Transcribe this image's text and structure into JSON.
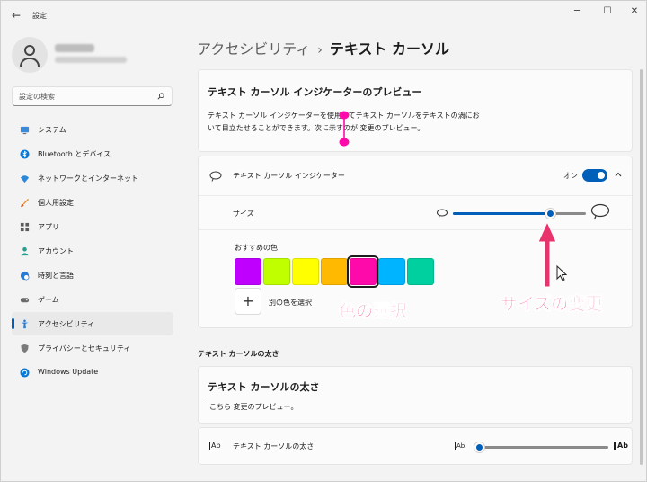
{
  "window": {
    "back_glyph": "←",
    "title": "設定",
    "controls": {
      "minimize": "─",
      "maximize": "☐",
      "close": "✕"
    }
  },
  "search": {
    "placeholder": "設定の検索",
    "value": ""
  },
  "sidebar": {
    "items": [
      {
        "label": "システム",
        "icon": "monitor-icon",
        "active": false
      },
      {
        "label": "Bluetooth とデバイス",
        "icon": "bluetooth-icon",
        "active": false
      },
      {
        "label": "ネットワークとインターネット",
        "icon": "wifi-icon",
        "active": false
      },
      {
        "label": "個人用設定",
        "icon": "brush-icon",
        "active": false
      },
      {
        "label": "アプリ",
        "icon": "apps-icon",
        "active": false
      },
      {
        "label": "アカウント",
        "icon": "person-icon",
        "active": false
      },
      {
        "label": "時刻と言語",
        "icon": "globe-clock-icon",
        "active": false
      },
      {
        "label": "ゲーム",
        "icon": "gamepad-icon",
        "active": false
      },
      {
        "label": "アクセシビリティ",
        "icon": "accessibility-icon",
        "active": true
      },
      {
        "label": "プライバシーとセキュリティ",
        "icon": "shield-icon",
        "active": false
      },
      {
        "label": "Windows Update",
        "icon": "update-icon",
        "active": false
      }
    ]
  },
  "breadcrumb": {
    "parent": "アクセシビリティ",
    "separator": "›",
    "current": "テキスト カーソル"
  },
  "preview": {
    "title": "テキスト カーソル インジケーターのプレビュー",
    "text": "テキスト カーソル インジケーターを使用してテキスト カーソルをテキストの渦において目立たせることができます。次に示すのが 変更のプレビュー。"
  },
  "indicator": {
    "label": "テキスト カーソル インジケーター",
    "toggle_state": "オン",
    "toggle_on": true,
    "size_label": "サイズ",
    "size_level": 0.73,
    "recommended_label": "おすすめの色",
    "colors": [
      "#bf00ff",
      "#bfff00",
      "#ffff00",
      "#ffb900",
      "#ff0aaa",
      "#00b4ff",
      "#00d0a0"
    ],
    "selected_color_index": 4,
    "custom_button": "+",
    "custom_label": "別の色を選択"
  },
  "thickness": {
    "section_heading": "テキスト カーソルの太さ",
    "card_title": "テキスト カーソルの太さ",
    "preview_text": "こちら 変更のプレビュー。",
    "row_label": "テキスト カーソルの太さ",
    "ab_icon": "Ab",
    "ab_small": "Ab",
    "ab_large": "Ab",
    "level": 0.0
  },
  "annotations": {
    "color_callout": "色の選択",
    "size_callout": "サイズの変更",
    "accent": "#e8336d"
  },
  "colors": {
    "accent": "#005fb8",
    "indicator_color": "#ff0aaa"
  }
}
